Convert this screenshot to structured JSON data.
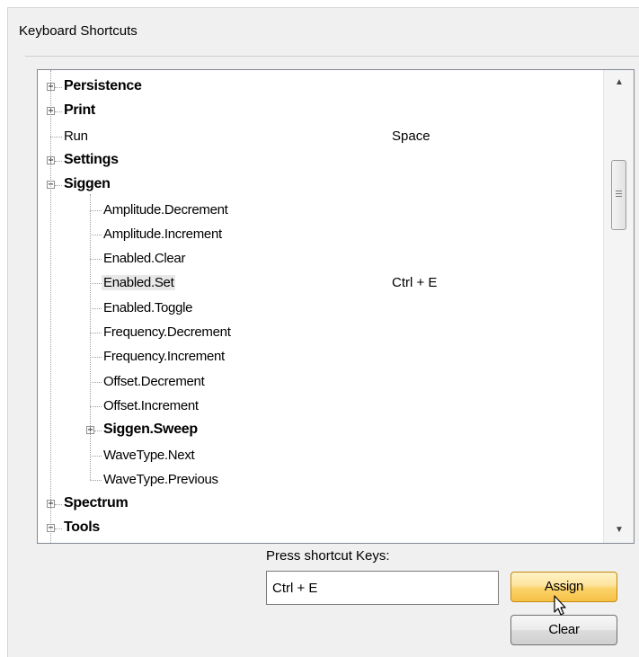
{
  "panel": {
    "title": "Keyboard Shortcuts"
  },
  "tree": {
    "rows": [
      {
        "label": "Persistence",
        "bold": true,
        "expander": "+",
        "shortcut": ""
      },
      {
        "label": "Print",
        "bold": true,
        "expander": "+",
        "shortcut": ""
      },
      {
        "label": "Run",
        "bold": false,
        "expander": "",
        "shortcut": "Space"
      },
      {
        "label": "Settings",
        "bold": true,
        "expander": "+",
        "shortcut": ""
      },
      {
        "label": "Siggen",
        "bold": true,
        "expander": "−",
        "shortcut": ""
      },
      {
        "label": "Amplitude.Decrement",
        "bold": false,
        "expander": "",
        "shortcut": ""
      },
      {
        "label": "Amplitude.Increment",
        "bold": false,
        "expander": "",
        "shortcut": ""
      },
      {
        "label": "Enabled.Clear",
        "bold": false,
        "expander": "",
        "shortcut": ""
      },
      {
        "label": "Enabled.Set",
        "bold": false,
        "expander": "",
        "shortcut": "Ctrl + E",
        "selected": true
      },
      {
        "label": "Enabled.Toggle",
        "bold": false,
        "expander": "",
        "shortcut": ""
      },
      {
        "label": "Frequency.Decrement",
        "bold": false,
        "expander": "",
        "shortcut": ""
      },
      {
        "label": "Frequency.Increment",
        "bold": false,
        "expander": "",
        "shortcut": ""
      },
      {
        "label": "Offset.Decrement",
        "bold": false,
        "expander": "",
        "shortcut": ""
      },
      {
        "label": "Offset.Increment",
        "bold": false,
        "expander": "",
        "shortcut": ""
      },
      {
        "label": "Siggen.Sweep",
        "bold": true,
        "expander": "+",
        "shortcut": ""
      },
      {
        "label": "WaveType.Next",
        "bold": false,
        "expander": "",
        "shortcut": ""
      },
      {
        "label": "WaveType.Previous",
        "bold": false,
        "expander": "",
        "shortcut": ""
      },
      {
        "label": "Spectrum",
        "bold": true,
        "expander": "+",
        "shortcut": ""
      },
      {
        "label": "Tools",
        "bold": true,
        "expander": "−",
        "shortcut": ""
      }
    ]
  },
  "shortcut_entry": {
    "label": "Press shortcut Keys:",
    "value": "Ctrl + E"
  },
  "buttons": {
    "assign": "Assign",
    "clear": "Clear"
  },
  "icons": {
    "scroll_up": "scroll-up-arrow-icon",
    "scroll_down": "scroll-down-arrow-icon",
    "cursor": "mouse-pointer-icon"
  },
  "colors": {
    "assign_button": "#fbd36a",
    "panel_bg": "#f0f0f0"
  }
}
